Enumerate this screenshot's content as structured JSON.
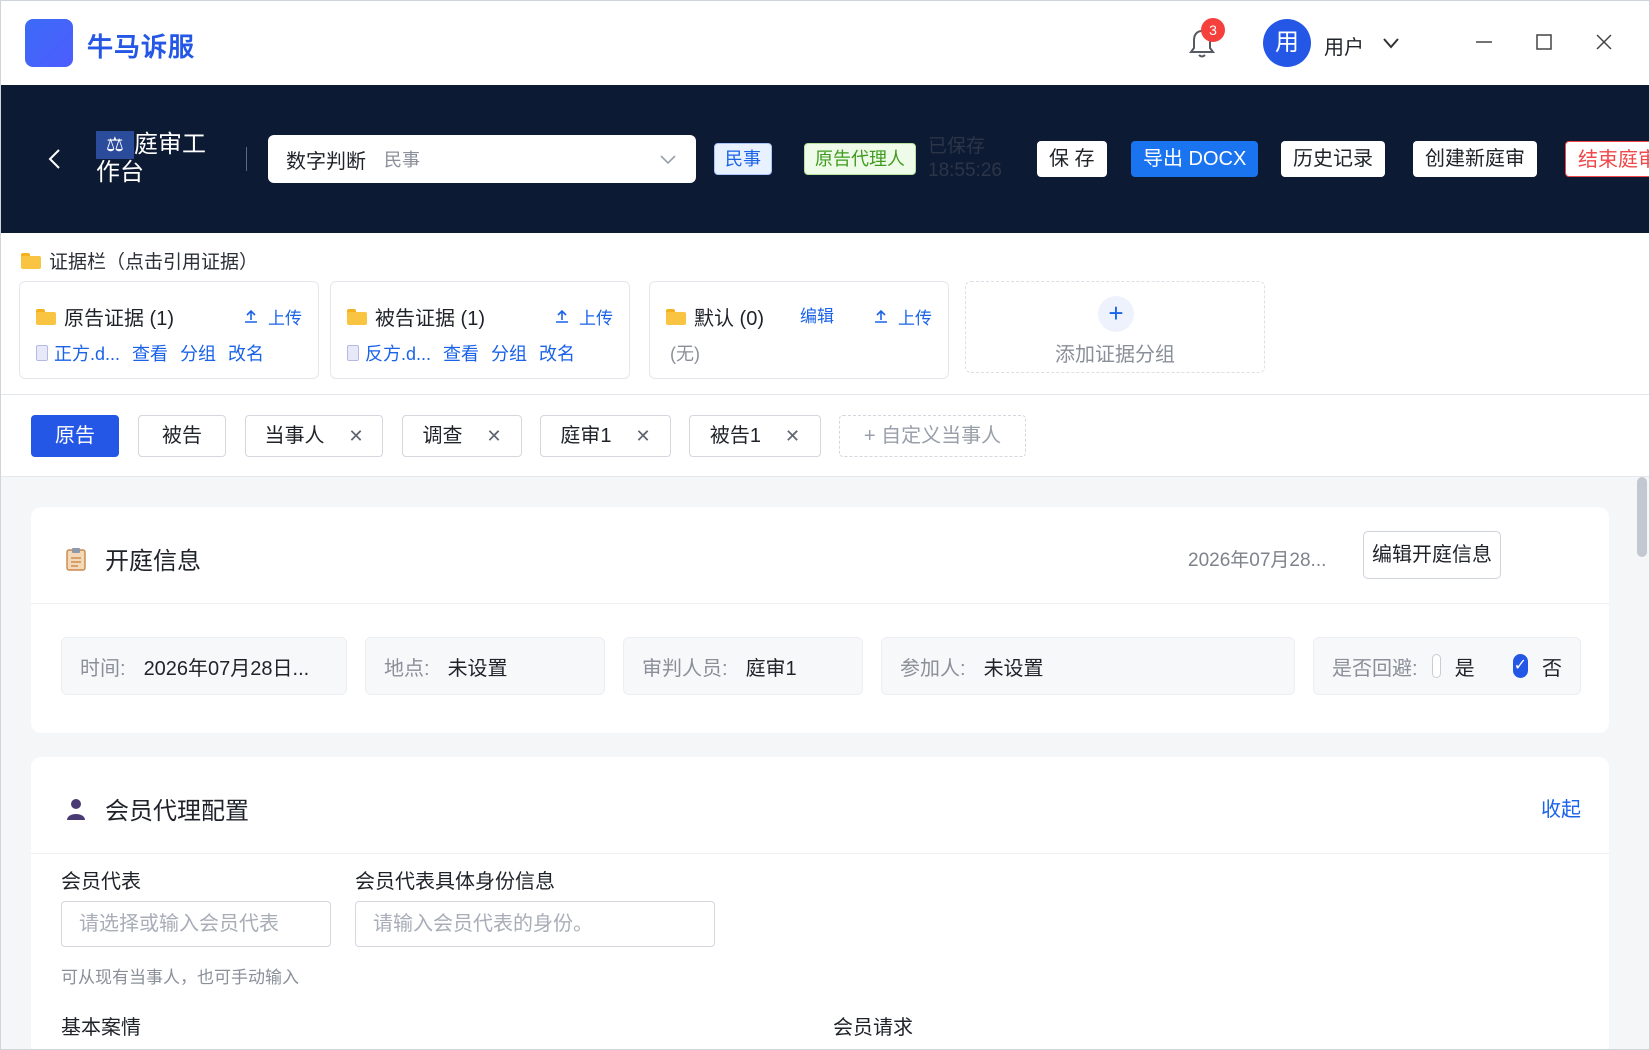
{
  "app": {
    "name": "牛马诉服",
    "notification_count": "3",
    "user_avatar": "用",
    "user_name": "用户"
  },
  "header": {
    "workspace_title": "庭审工作台",
    "case_name": "数字判断",
    "case_type": "民事",
    "tag_civil": "民事",
    "tag_role": "原告代理人",
    "saved_label": "已保存",
    "saved_time": "18:55:26",
    "buttons": {
      "save": "保 存",
      "export": "导出 DOCX",
      "history": "历史记录",
      "new_hearing": "创建新庭审",
      "end": "结束庭审"
    }
  },
  "evidence": {
    "title": "证据栏（点击引用证据）",
    "groups": [
      {
        "name": "原告证据 (1)",
        "upload": "上传",
        "file": "正方.d...",
        "actions": [
          "查看",
          "分组",
          "改名"
        ]
      },
      {
        "name": "被告证据 (1)",
        "upload": "上传",
        "file": "反方.d...",
        "actions": [
          "查看",
          "分组",
          "改名"
        ]
      },
      {
        "name": "默认 (0)",
        "edit": "编辑",
        "upload": "上传",
        "empty": "(无)"
      }
    ],
    "add_group": "添加证据分组"
  },
  "parties": {
    "tabs": [
      {
        "label": "原告"
      },
      {
        "label": "被告"
      },
      {
        "label": "当事人"
      },
      {
        "label": "调查"
      },
      {
        "label": "庭审1"
      },
      {
        "label": "被告1"
      }
    ],
    "custom": "+ 自定义当事人"
  },
  "hearing_info": {
    "title": "开庭信息",
    "date_summary": "2026年07月28...",
    "edit_button": "编辑开庭信息",
    "fields": {
      "time_label": "时间:",
      "time_value": "2026年07月28日...",
      "place_label": "地点:",
      "place_value": "未设置",
      "judge_label": "审判人员:",
      "judge_value": "庭审1",
      "participants_label": "参加人:",
      "participants_value": "未设置",
      "recusal_label": "是否回避:",
      "recusal_yes": "是",
      "recusal_no": "否"
    }
  },
  "member_proxy": {
    "title": "会员代理配置",
    "collapse": "收起",
    "rep_label": "会员代表",
    "rep_placeholder": "请选择或输入会员代表",
    "rep_hint": "可从现有当事人，也可手动输入",
    "identity_label": "会员代表具体身份信息",
    "identity_placeholder": "请输入会员代表的身份。",
    "basic_case_label": "基本案情",
    "member_request_label": "会员请求"
  }
}
